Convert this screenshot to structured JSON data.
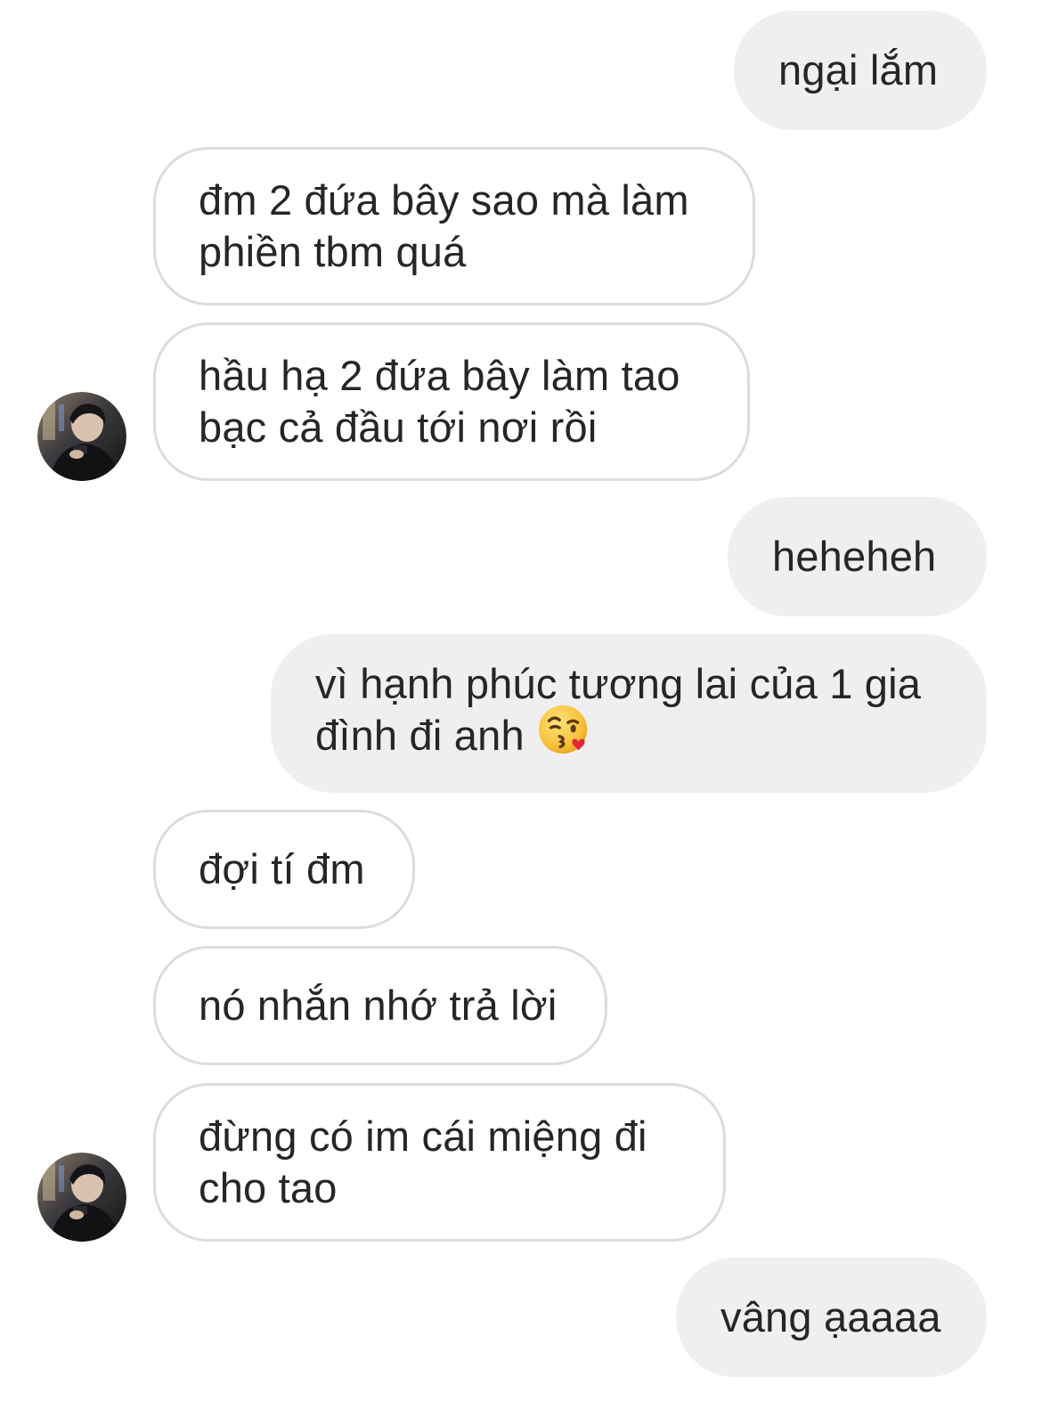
{
  "conversation": {
    "messages": [
      {
        "id": "m1",
        "sender": "me",
        "text": "ngại lắm"
      },
      {
        "id": "m2",
        "sender": "them",
        "lines": [
          "đm 2 đứa bây sao mà làm",
          "phiền tbm quá"
        ]
      },
      {
        "id": "m3",
        "sender": "them",
        "lines": [
          "hầu hạ 2 đứa bây làm tao",
          "bạc cả đầu tới nơi rồi"
        ]
      },
      {
        "id": "m4",
        "sender": "me",
        "text": "heheheh"
      },
      {
        "id": "m5",
        "sender": "me",
        "lines": [
          "vì hạnh phúc tương lai của 1 gia",
          "đình đi anh"
        ],
        "emoji": "face-blowing-kiss"
      },
      {
        "id": "m6",
        "sender": "them",
        "text": "đợi tí đm"
      },
      {
        "id": "m7",
        "sender": "them",
        "text": "nó nhắn nhớ trả lời"
      },
      {
        "id": "m8",
        "sender": "them",
        "lines": [
          "đừng có im cái miệng đi",
          "cho tao"
        ]
      },
      {
        "id": "m9",
        "sender": "me",
        "text": "vâng ạaaaa"
      }
    ]
  },
  "colors": {
    "outgoing_bubble": "#efefef",
    "incoming_border": "#dcdcdc",
    "text": "#262626"
  },
  "icons": {
    "avatar": "contact-avatar-photo",
    "emoji": "face-blowing-kiss-emoji"
  }
}
